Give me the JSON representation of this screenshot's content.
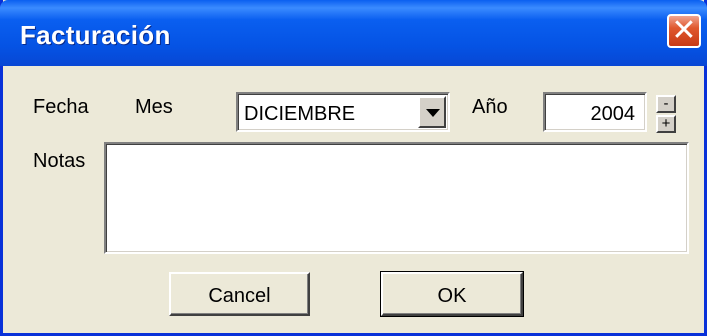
{
  "window": {
    "title": "Facturación"
  },
  "titlebar": {
    "close_icon": "close-icon",
    "close_glyph": "✕"
  },
  "form": {
    "fecha_label": "Fecha",
    "mes_label": "Mes",
    "mes_value": "DICIEMBRE",
    "anio_label": "Año",
    "anio_value": "2004",
    "spin_down": "-",
    "spin_up": "+",
    "notas_label": "Notas",
    "notas_value": ""
  },
  "buttons": {
    "cancel_label": "Cancel",
    "ok_label": "OK"
  }
}
